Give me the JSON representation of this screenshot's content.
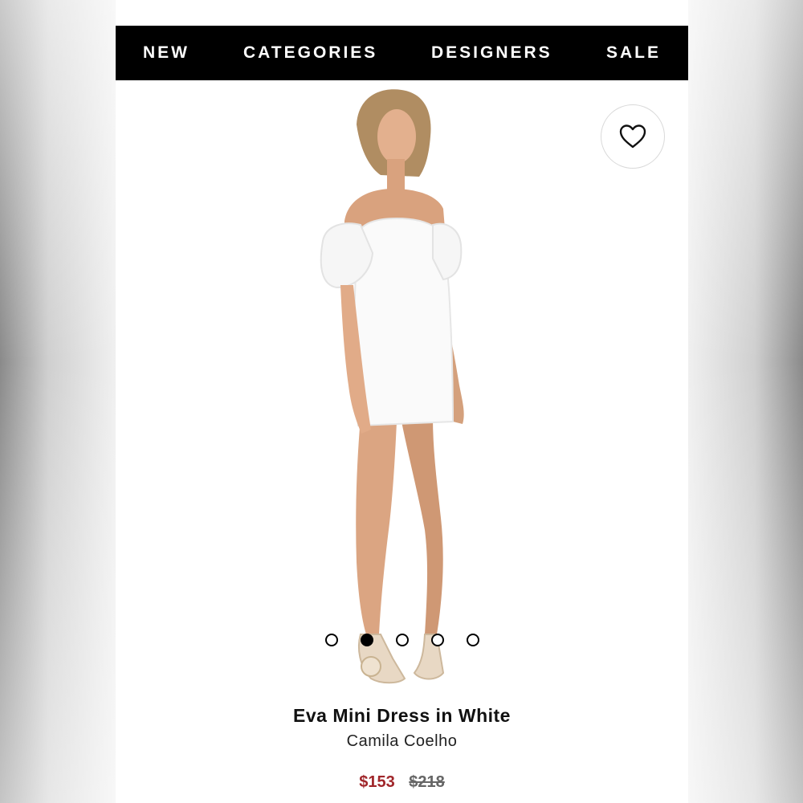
{
  "nav": {
    "items": [
      {
        "label": "NEW"
      },
      {
        "label": "CATEGORIES"
      },
      {
        "label": "DESIGNERS"
      },
      {
        "label": "SALE"
      }
    ]
  },
  "wishlist": {
    "icon": "heart-outline-icon"
  },
  "gallery": {
    "image_count": 5,
    "active_index": 1
  },
  "product": {
    "title": "Eva Mini Dress in White",
    "brand": "Camila Coelho",
    "price_sale": "$153",
    "price_original": "$218"
  },
  "colors": {
    "nav_background": "#000000",
    "sale_price": "#a0262a",
    "original_price": "#666666"
  }
}
